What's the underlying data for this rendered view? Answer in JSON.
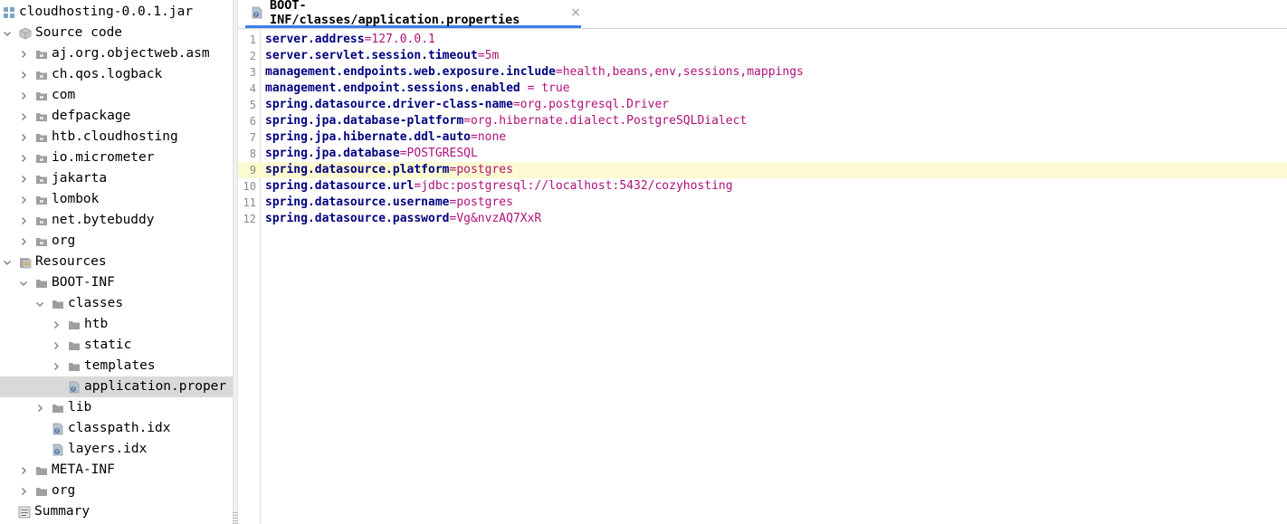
{
  "tree": {
    "root": {
      "label": "cloudhosting-0.0.1.jar",
      "icon": "jar-icon"
    },
    "source_code": {
      "label": "Source code",
      "icon": "source-package-icon"
    },
    "packages": [
      {
        "label": "aj.org.objectweb.asm"
      },
      {
        "label": "ch.qos.logback"
      },
      {
        "label": "com"
      },
      {
        "label": "defpackage"
      },
      {
        "label": "htb.cloudhosting"
      },
      {
        "label": "io.micrometer"
      },
      {
        "label": "jakarta"
      },
      {
        "label": "lombok"
      },
      {
        "label": "net.bytebuddy"
      },
      {
        "label": "org"
      }
    ],
    "resources": {
      "label": "Resources"
    },
    "boot_inf": {
      "label": "BOOT-INF"
    },
    "classes": {
      "label": "classes"
    },
    "class_children": [
      {
        "label": "htb"
      },
      {
        "label": "static"
      },
      {
        "label": "templates"
      }
    ],
    "selected_file": {
      "label": "application.proper"
    },
    "lib": {
      "label": "lib"
    },
    "classpath": {
      "label": "classpath.idx"
    },
    "layers": {
      "label": "layers.idx"
    },
    "meta_inf": {
      "label": "META-INF"
    },
    "res_org": {
      "label": "org"
    },
    "summary": {
      "label": "Summary"
    }
  },
  "tab": {
    "title": "BOOT-INF/classes/application.properties",
    "close": "×"
  },
  "editor": {
    "current_line": 9,
    "lines": [
      {
        "num": "1",
        "key": "server.address",
        "sep": "=",
        "value": "127.0.0.1"
      },
      {
        "num": "2",
        "key": "server.servlet.session.timeout",
        "sep": "=",
        "value": "5m"
      },
      {
        "num": "3",
        "key": "management.endpoints.web.exposure.include",
        "sep": "=",
        "value": "health,beans,env,sessions,mappings"
      },
      {
        "num": "4",
        "key": "management.endpoint.sessions.enabled",
        "sep": " = ",
        "value": "true"
      },
      {
        "num": "5",
        "key": "spring.datasource.driver-class-name",
        "sep": "=",
        "value": "org.postgresql.Driver"
      },
      {
        "num": "6",
        "key": "spring.jpa.database-platform",
        "sep": "=",
        "value": "org.hibernate.dialect.PostgreSQLDialect"
      },
      {
        "num": "7",
        "key": "spring.jpa.hibernate.ddl-auto",
        "sep": "=",
        "value": "none"
      },
      {
        "num": "8",
        "key": "spring.jpa.database",
        "sep": "=",
        "value": "POSTGRESQL"
      },
      {
        "num": "9",
        "key": "spring.datasource.platform",
        "sep": "=",
        "value": "postgres"
      },
      {
        "num": "10",
        "key": "spring.datasource.url",
        "sep": "=",
        "value": "jdbc:postgresql://localhost:5432/cozyhosting"
      },
      {
        "num": "11",
        "key": "spring.datasource.username",
        "sep": "=",
        "value": "postgres"
      },
      {
        "num": "12",
        "key": "spring.datasource.password",
        "sep": "=",
        "value": "Vg&nvzAQ7XxR"
      }
    ]
  },
  "colors": {
    "key": "#000080",
    "value": "#b0117a",
    "current_line": "#fcfad0",
    "selection": "#d9d9d9",
    "tab_underline": "#3d7ee6"
  }
}
